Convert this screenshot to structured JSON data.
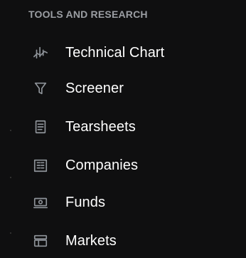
{
  "section": {
    "title": "TOOLS AND RESEARCH"
  },
  "menu": {
    "items": [
      {
        "label": "Technical Chart",
        "icon": "technical-chart-icon"
      },
      {
        "label": "Screener",
        "icon": "filter-icon"
      },
      {
        "label": "Tearsheets",
        "icon": "document-icon"
      },
      {
        "label": "Companies",
        "icon": "building-icon"
      },
      {
        "label": "Funds",
        "icon": "money-icon"
      },
      {
        "label": "Markets",
        "icon": "market-icon"
      }
    ]
  },
  "colors": {
    "background": "#0f0f10",
    "section_title": "#9b9ea3",
    "item_text": "#ffffff",
    "icon_stroke": "#8f949a"
  }
}
